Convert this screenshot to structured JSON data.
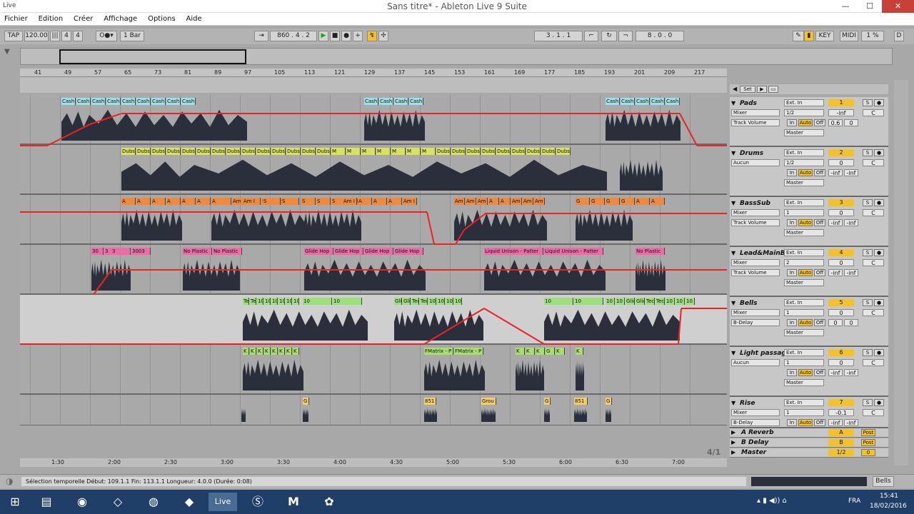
{
  "window": {
    "title": "Sans titre* - Ableton Live 9 Suite",
    "app_badge": "Live",
    "min": "—",
    "max": "☐",
    "close": "✕"
  },
  "menu": [
    "Fichier",
    "Edition",
    "Créer",
    "Affichage",
    "Options",
    "Aide"
  ],
  "control_bar": {
    "tap": "TAP",
    "tempo": "120.00",
    "meter_left": "4",
    "meter_right": "4",
    "quantize": "1 Bar",
    "position": "860 .  4 .  2",
    "loop_start": "3 .  1 .  1",
    "loop_length": "8 .  0 .  0",
    "key": "KEY",
    "midi": "MIDI",
    "cpu": "1 %",
    "d": "D"
  },
  "ruler_ticks": [
    "41",
    "49",
    "57",
    "65",
    "73",
    "81",
    "89",
    "97",
    "105",
    "113",
    "121",
    "129",
    "137",
    "145",
    "153",
    "161",
    "169",
    "177",
    "185",
    "193",
    "201",
    "209",
    "217"
  ],
  "set_button": "Set",
  "time_ticks": [
    "1:30",
    "2:00",
    "2:30",
    "3:00",
    "3:30",
    "4:00",
    "4:30",
    "5:00",
    "5:30",
    "6:00",
    "6:30",
    "7:00"
  ],
  "loop_counter": "4/1",
  "tracks": [
    {
      "name": "Pads",
      "input": "Ext. In",
      "routing": "Mixer",
      "auto": "Track Volume",
      "ch": "1/2",
      "out": "Master",
      "num": "1",
      "vol": "-inf",
      "pan": "C",
      "s2": "0.6",
      "s3": "0",
      "clip_labels": [
        "Cash",
        "Cash",
        "Cash",
        "Cash",
        "Cash",
        "Cash",
        "Cash",
        "Cash",
        "Cash",
        "Cash",
        "Cash",
        "Cash",
        "Cash",
        "Cash",
        "Cash",
        "Cash",
        "Cash",
        "Cash",
        "Cash",
        "Cash",
        "Cash",
        "Cash"
      ]
    },
    {
      "name": "Drums",
      "input": "Ext. In",
      "routing": "Aucun",
      "auto": "",
      "ch": "1/2",
      "out": "Master",
      "num": "2",
      "vol": "0",
      "pan": "C",
      "s2": "-inf",
      "s3": "-inf",
      "clip_labels": [
        "Dubs",
        "Dubs",
        "Dubs",
        "Dubs",
        "Dubs",
        "Dubs",
        "Dubs",
        "Dubs",
        "Dubs",
        "Dubs",
        "Dubs",
        "Dubs",
        "Dubs",
        "Dubs",
        "M",
        "M",
        "M",
        "M",
        "M",
        "M",
        "M",
        "Dubs",
        "Dubs",
        "Dubs",
        "Dubs",
        "Dubs",
        "Dubs",
        "Dubs",
        "Dubs",
        "Dubs"
      ]
    },
    {
      "name": "BassSub",
      "input": "Ext. In",
      "routing": "Mixer",
      "auto": "Track Volume",
      "ch": "1",
      "out": "Master",
      "num": "3",
      "vol": "0",
      "pan": "C",
      "s2": "-inf",
      "s3": "-inf",
      "clip_labels": [
        "A",
        "A",
        "A",
        "A",
        "A",
        "A",
        "A",
        "Am I",
        "Am I",
        "S",
        "S",
        "S",
        "S",
        "S",
        "S",
        "S",
        "Am I",
        "Am I",
        "A",
        "A",
        "A",
        "Am I",
        "Am I",
        "Am I",
        "Am I",
        "A",
        "A",
        "Am I",
        "Am I",
        "Am I",
        "G",
        "G",
        "G",
        "G",
        "A",
        "A",
        "A"
      ]
    },
    {
      "name": "Lead&MainB",
      "input": "Ext. In",
      "routing": "Mixer",
      "auto": "Track Volume",
      "ch": "2",
      "out": "Master",
      "num": "4",
      "vol": "0",
      "pan": "C",
      "s2": "-inf",
      "s3": "-inf",
      "clip_labels": [
        "30",
        "3",
        "3",
        "3003",
        "No Plastic",
        "No Plastic",
        "Glide Hop",
        "Glide Hop",
        "Glide Hop",
        "Glide Hop",
        "Liquid Unison - Patter",
        "Liquid Unison - Patter",
        "No Plastic"
      ]
    },
    {
      "name": "Bells",
      "input": "Ext. In",
      "routing": "Mixer",
      "auto": "B-Delay",
      "ch": "1",
      "out": "Master",
      "num": "5",
      "vol": "0",
      "pan": "C",
      "s2": "0",
      "s3": "0",
      "clip_labels": [
        "Tech Hous",
        "Tech Hous",
        "10",
        "10",
        "10",
        "10",
        "10",
        "10",
        "10",
        "10",
        "Glide Hop",
        "Glide Hop"
      ]
    },
    {
      "name": "Light passag",
      "input": "Ext. In",
      "routing": "Aucun",
      "auto": "",
      "ch": "1",
      "out": "Master",
      "num": "6",
      "vol": "0",
      "pan": "C",
      "s2": "-inf",
      "s3": "-inf",
      "clip_labels": [
        "K",
        "K",
        "K",
        "K",
        "K",
        "K",
        "K",
        "K",
        "FMatrix - P",
        "FMatrix - P",
        "K",
        "K",
        "K",
        "G"
      ]
    },
    {
      "name": "Rise",
      "input": "Ext. In",
      "routing": "Mixer",
      "auto": "B-Delay",
      "ch": "1",
      "out": "Master",
      "num": "7",
      "vol": "-0.1",
      "pan": "C",
      "s2": "-inf",
      "s3": "-inf",
      "clip_labels": [
        "G",
        "851",
        "Grou",
        "G",
        "851",
        "G"
      ]
    }
  ],
  "returns": [
    {
      "name": "A Reverb",
      "letter": "A",
      "post": "Post"
    },
    {
      "name": "B Delay",
      "letter": "B",
      "post": "Post"
    },
    {
      "name": "Master",
      "letter": "1/2",
      "num": "0",
      "post": "0"
    }
  ],
  "mix_labels": {
    "in": "In",
    "auto": "Auto",
    "off": "Off",
    "solo": "S"
  },
  "status": {
    "text": "Sélection temporelle     Début: 109.1.1     Fin: 113.1.1     Longueur: 4.0.0  (Durée: 0:08)",
    "right_button": "Bells"
  },
  "taskbar": {
    "lang": "FRA",
    "time": "15:41",
    "date": "18/02/2016",
    "live_label": "Live",
    "m_label": "M"
  }
}
